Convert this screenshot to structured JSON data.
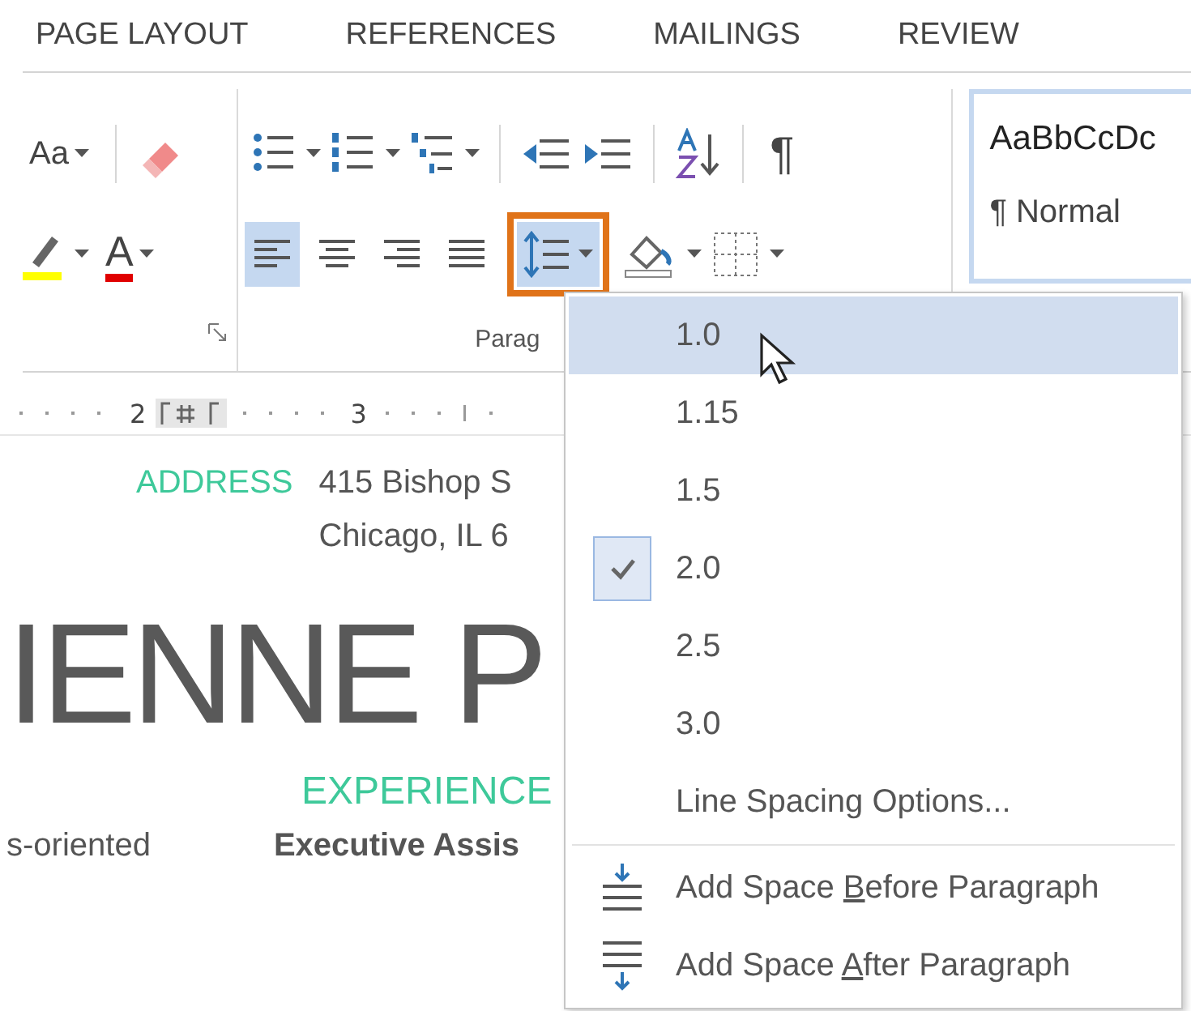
{
  "tabs": [
    {
      "label": "PAGE LAYOUT",
      "selected": false
    },
    {
      "label": "REFERENCES",
      "selected": false
    },
    {
      "label": "MAILINGS",
      "selected": false
    },
    {
      "label": "REVIEW",
      "selected": false
    }
  ],
  "font_group": {
    "font_size_label": "Aa",
    "font_color_letter": "A"
  },
  "paragraph_group": {
    "label": "Parag",
    "pilcrow": "¶",
    "alignments": [
      {
        "kind": "left",
        "selected": true
      },
      {
        "kind": "center",
        "selected": false
      },
      {
        "kind": "right",
        "selected": false
      },
      {
        "kind": "justify",
        "selected": false
      }
    ],
    "line_spacing_button": {
      "open": true,
      "highlighted": true
    }
  },
  "styles": {
    "preview": "AaBbCcDc",
    "name": "¶ Normal"
  },
  "ruler": {
    "numbers": [
      "2",
      "3"
    ]
  },
  "document": {
    "address_label": "ADDRESS",
    "address_lines": [
      "415 Bishop S",
      "Chicago, IL 6"
    ],
    "name": "IENNE P",
    "section": "EXPERIENCE",
    "left_text": "s-oriented",
    "job_title": "Executive Assis"
  },
  "line_spacing_menu": {
    "values": [
      {
        "label": "1.0",
        "selected": true,
        "checked": false
      },
      {
        "label": "1.15",
        "selected": false,
        "checked": false
      },
      {
        "label": "1.5",
        "selected": false,
        "checked": false
      },
      {
        "label": "2.0",
        "selected": false,
        "checked": true
      },
      {
        "label": "2.5",
        "selected": false,
        "checked": false
      },
      {
        "label": "3.0",
        "selected": false,
        "checked": false
      }
    ],
    "options": "Line Spacing Options...",
    "actions": [
      {
        "kind": "before",
        "label_start": "Add Space ",
        "access_key": "B",
        "label_end": "efore Paragraph"
      },
      {
        "kind": "after",
        "label_start": "Add Space ",
        "access_key": "A",
        "label_end": "fter Paragraph"
      }
    ]
  }
}
